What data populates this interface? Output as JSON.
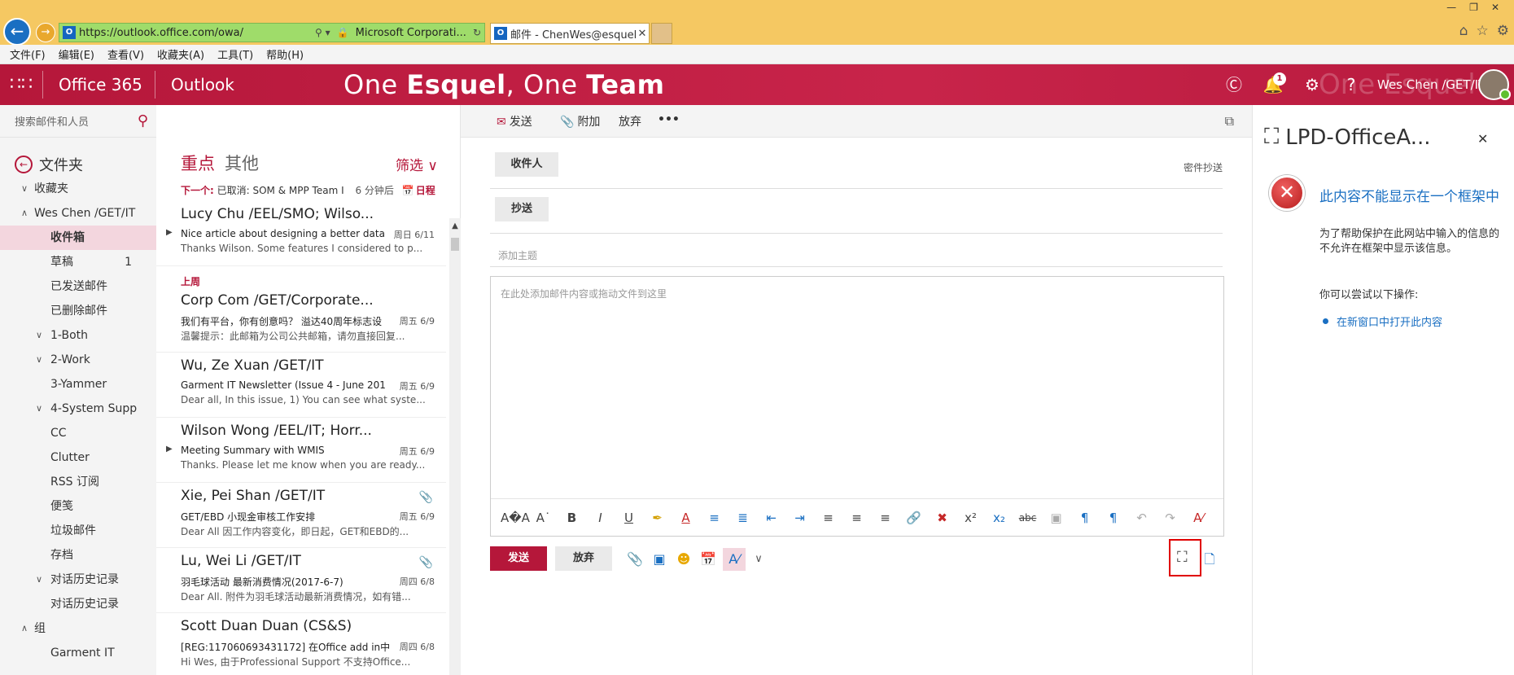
{
  "browser": {
    "url": "https://outlook.office.com/owa/",
    "cert": "Microsoft Corporati...",
    "tab_title": "邮件 - ChenWes@esquel....",
    "menu": [
      "文件(F)",
      "编辑(E)",
      "查看(V)",
      "收藏夹(A)",
      "工具(T)",
      "帮助(H)"
    ]
  },
  "suite": {
    "brand": "Office 365",
    "app": "Outlook",
    "banner_pre": "One ",
    "banner_b1": "Esquel",
    "banner_mid": ", One ",
    "banner_b2": "Team",
    "notif_count": "1",
    "user": "Wes Chen /GET/IT",
    "ghost": "One  Esquel"
  },
  "folders": {
    "search_placeholder": "搜索邮件和人员",
    "header": "文件夹",
    "items": [
      {
        "label": "收藏夹",
        "count": ""
      },
      {
        "label": "Wes Chen /GET/IT",
        "count": ""
      },
      {
        "label": "收件箱",
        "count": ""
      },
      {
        "label": "草稿",
        "count": "1"
      },
      {
        "label": "已发送邮件",
        "count": ""
      },
      {
        "label": "已删除邮件",
        "count": ""
      },
      {
        "label": "1-Both",
        "count": ""
      },
      {
        "label": "2-Work",
        "count": ""
      },
      {
        "label": "3-Yammer",
        "count": ""
      },
      {
        "label": "4-System Supp",
        "count": ""
      },
      {
        "label": "CC",
        "count": ""
      },
      {
        "label": "Clutter",
        "count": ""
      },
      {
        "label": "RSS 订阅",
        "count": ""
      },
      {
        "label": "便笺",
        "count": ""
      },
      {
        "label": "垃圾邮件",
        "count": ""
      },
      {
        "label": "存档",
        "count": ""
      },
      {
        "label": "对话历史记录",
        "count": ""
      },
      {
        "label": "对话历史记录",
        "count": ""
      },
      {
        "label": "组",
        "count": ""
      },
      {
        "label": "Garment IT",
        "count": ""
      }
    ]
  },
  "list": {
    "focused": "重点",
    "other": "其他",
    "filter": "筛选",
    "next_label": "下一个:",
    "next_text": "已取消: SOM & MPP Team I",
    "next_time": "6 分钟后",
    "next_cal": "日程",
    "group_last_week": "上周",
    "messages": [
      {
        "from": "Lucy Chu /EEL/SMO; Wilso...",
        "subject": "Nice article about designing a better data",
        "preview": "Thanks Wilson. Some features I considered to p...",
        "date": "周日 6/11"
      },
      {
        "from": "Corp Com /GET/Corporate...",
        "subject": "我们有平台，你有创意吗？ 溢达40周年标志设",
        "preview": "温馨提示：此邮箱为公司公共邮箱，请勿直接回复...",
        "date": "周五 6/9"
      },
      {
        "from": "Wu, Ze Xuan /GET/IT",
        "subject": "Garment IT Newsletter (Issue 4 - June 201",
        "preview": "Dear all, In this issue, 1) You can see what syste...",
        "date": "周五 6/9"
      },
      {
        "from": "Wilson Wong /EEL/IT; Horr...",
        "subject": "Meeting Summary with WMIS",
        "preview": "Thanks. Please let me know when you are ready...",
        "date": "周五 6/9"
      },
      {
        "from": "Xie, Pei Shan /GET/IT",
        "subject": "GET/EBD 小现金审核工作安排",
        "preview": "Dear All 因工作内容变化，即日起，GET和EBD的...",
        "date": "周五 6/9"
      },
      {
        "from": "Lu, Wei Li /GET/IT",
        "subject": "羽毛球活动 最新消费情况(2017-6-7)",
        "preview": "Dear All. 附件为羽毛球活动最新消费情况，如有错...",
        "date": "周四 6/8"
      },
      {
        "from": "Scott Duan Duan (CS&S)",
        "subject": "[REG:117060693431172] 在Office add in中",
        "preview": "Hi Wes, 由于Professional Support 不支持Office...",
        "date": "周四 6/8"
      }
    ]
  },
  "compose": {
    "send": "发送",
    "attach": "附加",
    "discard": "放弃",
    "to": "收件人",
    "cc": "抄送",
    "bcc": "密件抄送",
    "subject_placeholder": "添加主题",
    "body_placeholder": "在此处添加邮件内容或拖动文件到这里"
  },
  "addin": {
    "title": "LPD-OfficeA...",
    "error_title": "此内容不能显示在一个框架中",
    "error_line1": "为了帮助保护在此网站中输入的信息的",
    "error_line2": "不允许在框架中显示该信息。",
    "try": "你可以尝试以下操作:",
    "link": "在新窗口中打开此内容"
  },
  "colors": {
    "accent": "#b5173a",
    "link": "#1a6fc2"
  }
}
